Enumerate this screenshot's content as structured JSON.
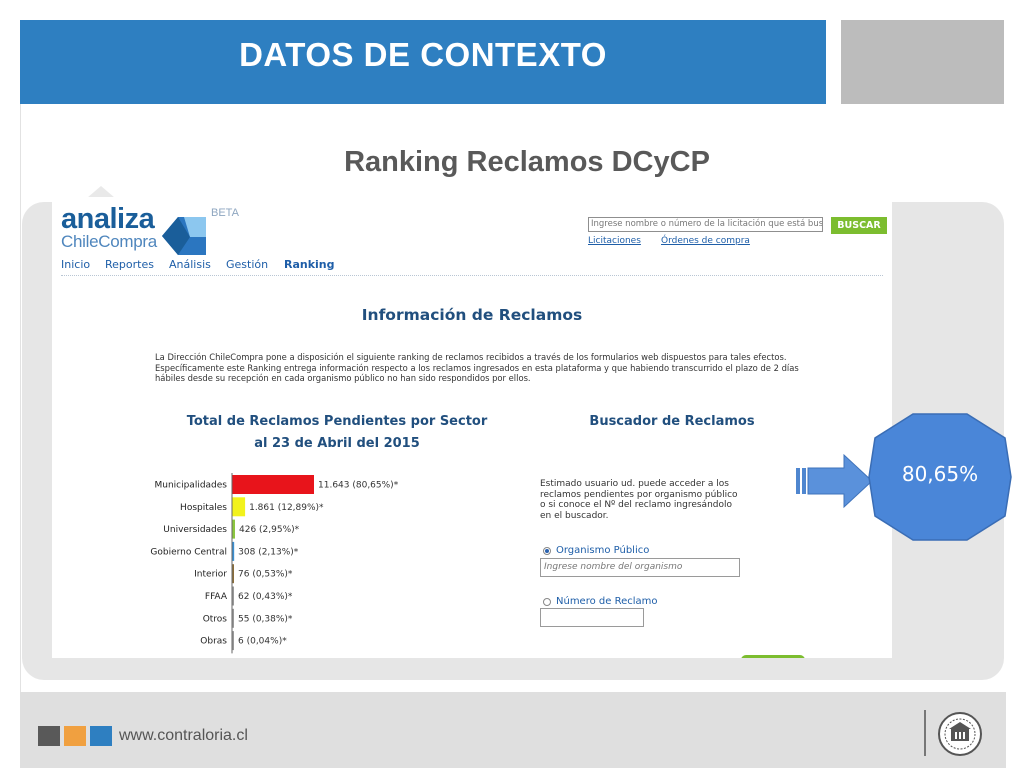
{
  "slide": {
    "title": "DATOS DE CONTEXTO",
    "subtitle": "Ranking Reclamos DCyCP",
    "callout_value": "80,65%",
    "footer_url": "www.contraloria.cl",
    "footer_squares": [
      "#595959",
      "#f0a040",
      "#2e7fc1"
    ]
  },
  "site": {
    "logo_main": "analiza",
    "logo_sub": "ChileCompra",
    "logo_badge": "BETA",
    "search_placeholder": "Ingrese nombre o número de la licitación que está buscando",
    "search_button": "BUSCAR",
    "link_licitaciones": "Licitaciones",
    "link_ordenes": "Órdenes de compra",
    "nav": [
      "Inicio",
      "Reportes",
      "Análisis",
      "Gestión",
      "Ranking"
    ],
    "page_title": "Información de Reclamos",
    "intro": "La Dirección ChileCompra pone a disposición el siguiente ranking de reclamos recibidos a través de los formularios web dispuestos para tales efectos. Específicamente este Ranking entrega información respecto a los reclamos ingresados en esta plataforma y que habiendo transcurrido el plazo de 2 días hábiles desde su recepción en cada organismo público no han sido respondidos por ellos.",
    "chart_title_line1": "Total de Reclamos Pendientes por Sector",
    "chart_title_line2": "al 23 de Abril del 2015",
    "search_title": "Buscador de Reclamos",
    "search_desc": "Estimado usuario ud. puede acceder a los reclamos pendientes por organismo público o si conoce el Nº del reclamo ingresándolo en el buscador.",
    "radio_organismo": "Organismo Público",
    "organismo_placeholder": "Ingrese nombre del organismo",
    "radio_numero": "Número de Reclamo"
  },
  "chart_data": {
    "type": "bar",
    "orientation": "horizontal",
    "title": "Total de Reclamos Pendientes por Sector al 23 de Abril del 2015",
    "categories": [
      "Municipalidades",
      "Hospitales",
      "Universidades",
      "Gobierno Central",
      "Interior",
      "FFAA",
      "Otros",
      "Obras"
    ],
    "values": [
      11643,
      1861,
      426,
      308,
      76,
      62,
      55,
      6
    ],
    "labels": [
      "11.643 (80,65%)*",
      "1.861 (12,89%)*",
      "426 (2,95%)*",
      "308 (2,13%)*",
      "76 (0,53%)*",
      "62 (0,43%)*",
      "55 (0,38%)*",
      "6 (0,04%)*"
    ],
    "colors": [
      "#e8141b",
      "#f2f21c",
      "#8cc63f",
      "#3a8fd1",
      "#8a6d3b",
      "#999999",
      "#999999",
      "#999999"
    ],
    "grid": false
  }
}
